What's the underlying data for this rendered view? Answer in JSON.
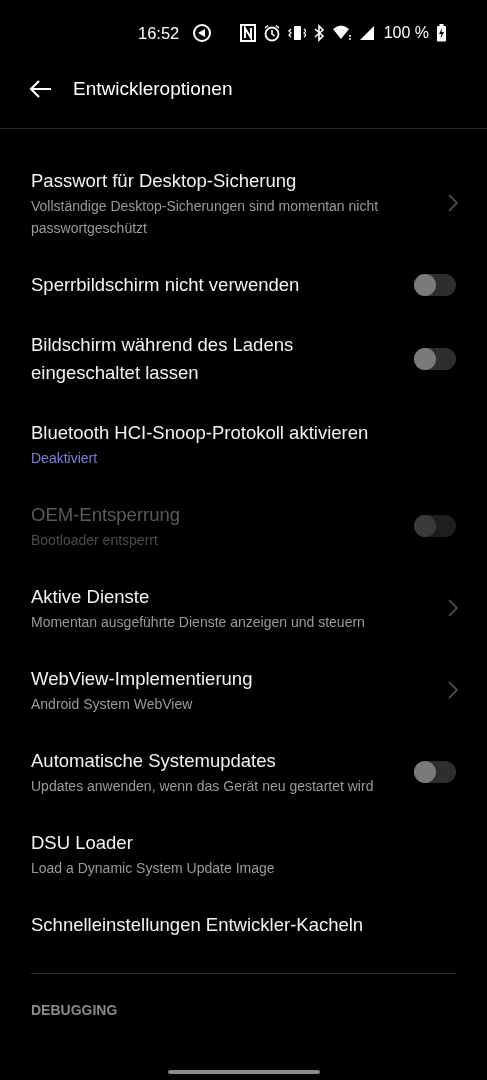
{
  "status_bar": {
    "time": "16:52",
    "battery": "100 %"
  },
  "header": {
    "title": "Entwickleroptionen"
  },
  "settings": [
    {
      "kind": "link",
      "title": "Passwort für Desktop-Sicherung",
      "summary": "Vollständige Desktop-Sicherungen sind momentan nicht passwortgeschützt",
      "accent": false,
      "disabled": false
    },
    {
      "kind": "toggle",
      "title": "Sperrbildschirm nicht verwenden",
      "on": false,
      "disabled": false
    },
    {
      "kind": "toggle",
      "title": "Bildschirm während des Ladens eingeschaltet lassen",
      "on": false,
      "disabled": false
    },
    {
      "kind": "plain",
      "title": "Bluetooth HCI-Snoop-Protokoll aktivieren",
      "summary": "Deaktiviert",
      "accent": true,
      "disabled": false
    },
    {
      "kind": "toggle",
      "title": "OEM-Entsperrung",
      "summary": "Bootloader entsperrt",
      "accent": false,
      "on": false,
      "disabled": true
    },
    {
      "kind": "link",
      "title": "Aktive Dienste",
      "summary": "Momentan ausgeführte Dienste anzeigen und steuern",
      "accent": false,
      "disabled": false
    },
    {
      "kind": "link",
      "title": "WebView-Implementierung",
      "summary": "Android System WebView",
      "accent": false,
      "disabled": false
    },
    {
      "kind": "toggle",
      "title": "Automatische Systemupdates",
      "summary": "Updates anwenden, wenn das Gerät neu gestartet wird",
      "accent": false,
      "on": false,
      "disabled": false
    },
    {
      "kind": "plain",
      "title": "DSU Loader",
      "summary": "Load a Dynamic System Update Image",
      "accent": false,
      "disabled": false
    },
    {
      "kind": "plain",
      "title": "Schnelleinstellungen Entwickler-Kacheln",
      "disabled": false
    }
  ],
  "section": {
    "title": "DEBUGGING"
  }
}
